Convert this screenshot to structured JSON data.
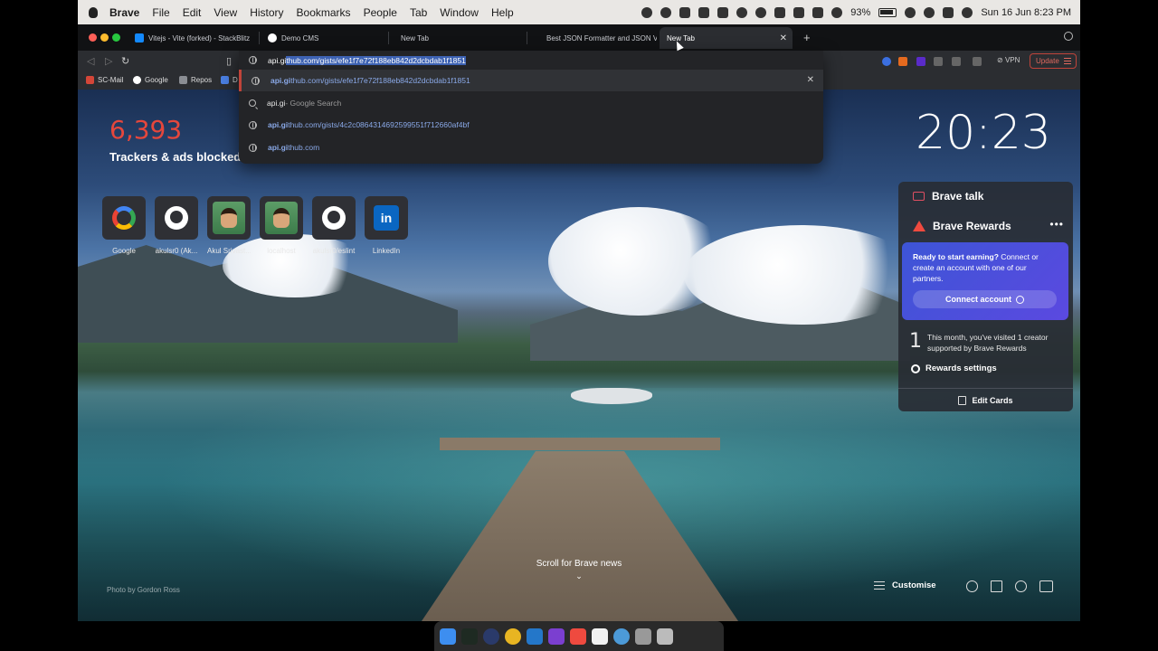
{
  "menubar": {
    "app_name": "Brave",
    "menus": [
      "File",
      "Edit",
      "View",
      "History",
      "Bookmarks",
      "People",
      "Tab",
      "Window",
      "Help"
    ],
    "battery": "93%",
    "datetime": "Sun 16 Jun  8:23 PM"
  },
  "tabs": [
    {
      "title": "Vitejs - Vite (forked) - StackBlitz",
      "favicon": "stackblitz-icon",
      "color": "#1389fd"
    },
    {
      "title": "Demo CMS",
      "favicon": "github-icon",
      "color": "#ffffff"
    },
    {
      "title": "New Tab",
      "favicon": "none",
      "color": ""
    },
    {
      "title": "Best JSON Formatter and JSON V",
      "favicon": "none",
      "color": ""
    },
    {
      "title": "New Tab",
      "favicon": "none",
      "color": "",
      "active": true
    }
  ],
  "toolbar": {
    "vpn_label": "VPN",
    "update_label": "Update"
  },
  "bookmarks": [
    {
      "label": "SC-Mail",
      "icon": "gmail-icon"
    },
    {
      "label": "Google",
      "icon": "google-icon"
    },
    {
      "label": "Repos",
      "icon": "folder-icon"
    },
    {
      "label": "D",
      "icon": "doc-icon"
    }
  ],
  "omnibox": {
    "typed": "api.gi",
    "autocomplete": "thub.com/gists/efe1f7e72f188eb842d2dcbdab1f1851",
    "suggestions": [
      {
        "match": "api.gi",
        "rest": "thub.com/gists/efe1f7e72f188eb842d2dcbdab1f1851",
        "kind": "url",
        "selected": true
      },
      {
        "match": "api.gi",
        "rest": " - Google Search",
        "kind": "search"
      },
      {
        "match": "api.gi",
        "rest": "thub.com/gists/4c2c0864314692599551f712660af4bf",
        "kind": "url"
      },
      {
        "match": "api.gi",
        "rest": "thub.com",
        "kind": "url"
      }
    ]
  },
  "ntp": {
    "trackers_count": "6,393",
    "trackers_label": "Trackers & ads blocked",
    "clock": "20:23",
    "top_sites": [
      {
        "name": "Google",
        "icon": "google-icon"
      },
      {
        "name": "akulsr0 (Ak...",
        "icon": "github-icon"
      },
      {
        "name": "Akul Srivast...",
        "icon": "avatar-icon"
      },
      {
        "name": "localhost",
        "icon": "avatar-icon"
      },
      {
        "name": "akulsr0/eslint",
        "icon": "github-icon"
      },
      {
        "name": "LinkedIn",
        "icon": "linkedin-icon"
      }
    ],
    "scroll_news": "Scroll for Brave news",
    "photo_credit": "Photo by Gordon Ross",
    "customise_label": "Customise"
  },
  "cards": {
    "talk_title": "Brave talk",
    "rewards_title": "Brave Rewards",
    "earn_heading": "Ready to start earning?",
    "earn_body": " Connect or create an account with one of our partners.",
    "connect_label": "Connect account",
    "visited_count": "1",
    "visited_text": "This month, you've visited 1 creator supported by Brave Rewards",
    "settings_label": "Rewards settings",
    "edit_label": "Edit Cards"
  }
}
